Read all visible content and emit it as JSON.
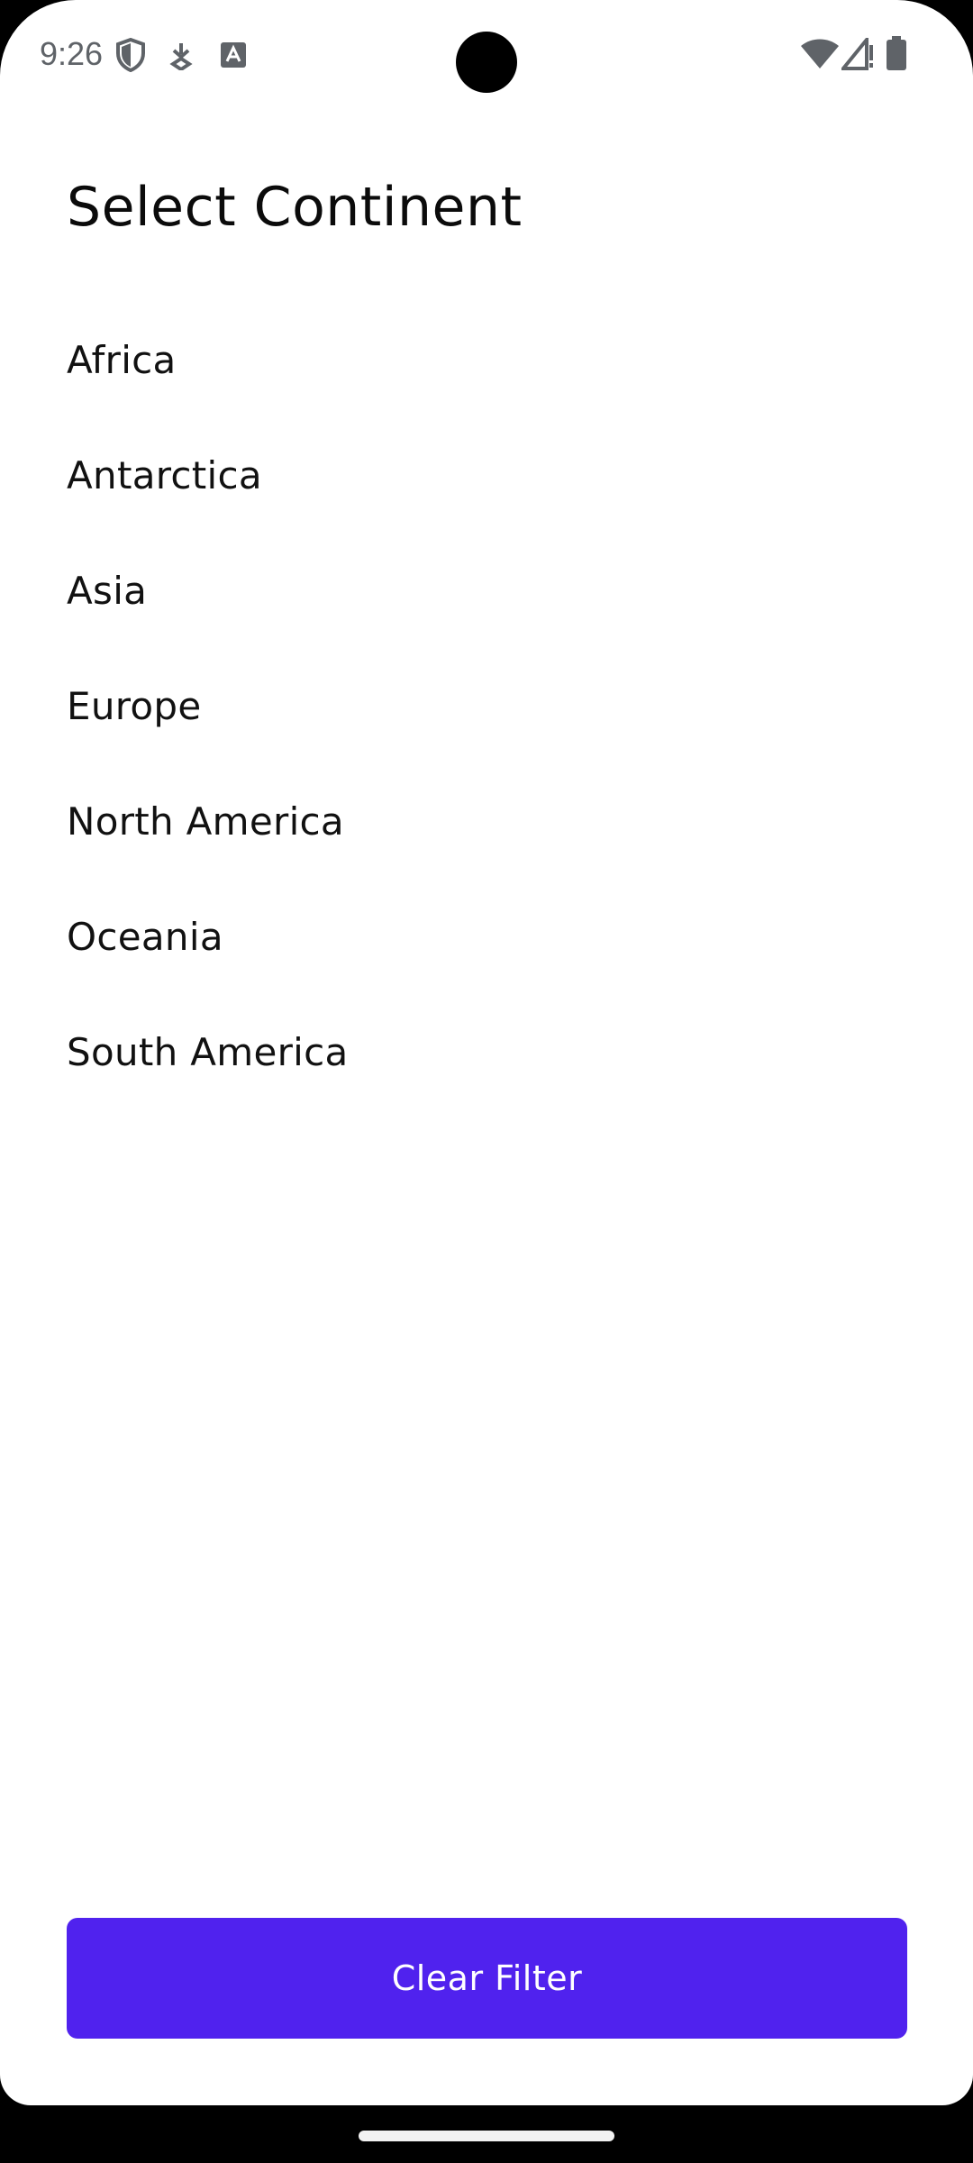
{
  "status_bar": {
    "time": "9:26",
    "icons": [
      "shield-icon",
      "download-icon",
      "font-a-icon",
      "wifi-icon",
      "cellular-signal-icon",
      "battery-icon"
    ]
  },
  "header": {
    "title": "Select Continent"
  },
  "continents": {
    "items": [
      {
        "label": "Africa"
      },
      {
        "label": "Antarctica"
      },
      {
        "label": "Asia"
      },
      {
        "label": "Europe"
      },
      {
        "label": "North America"
      },
      {
        "label": "Oceania"
      },
      {
        "label": "South America"
      }
    ]
  },
  "actions": {
    "clear_label": "Clear Filter"
  },
  "colors": {
    "accent": "#5022ee",
    "background": "#ffffff",
    "text": "#111111",
    "status_icon": "#5f6368"
  }
}
